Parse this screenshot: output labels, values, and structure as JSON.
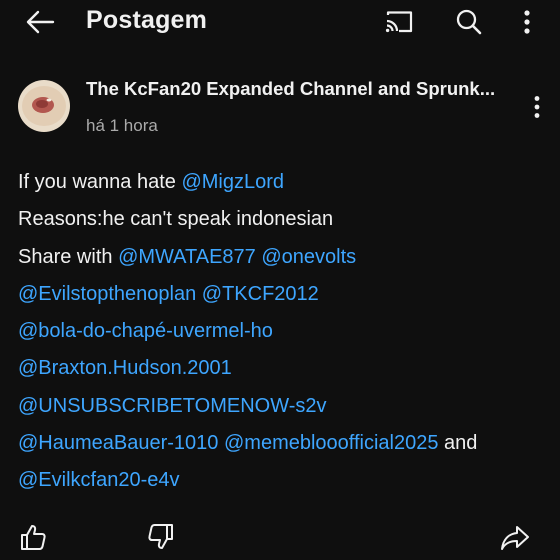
{
  "header": {
    "title": "Postagem",
    "icons": [
      "back-arrow-icon",
      "cast-icon",
      "search-icon",
      "more-vert-icon"
    ]
  },
  "post": {
    "channel_name": "The KcFan20 Expanded Channel and Sprunk...",
    "time_ago": "há 1 hora",
    "lines": [
      {
        "text": "If you wanna hate ",
        "mentions": [
          "@MigzLord"
        ]
      },
      {
        "text": "Reasons:he can't speak indonesian",
        "mentions": []
      },
      {
        "text": "Share with ",
        "mentions": [
          "@MWATAE877",
          "@onevolts"
        ]
      },
      {
        "text": "",
        "mentions": [
          "@Evilstopthenoplan",
          "@TKCF2012"
        ]
      },
      {
        "text": "",
        "mentions": [
          "@bola-do-chapé-uvermel-ho"
        ]
      },
      {
        "text": "",
        "mentions": [
          "@Braxton.Hudson.2001"
        ]
      },
      {
        "text": "",
        "mentions": [
          "@UNSUBSCRIBETOMENOW-s2v"
        ]
      },
      {
        "text": "",
        "mentions": [
          "@HaumeaBauer-1010",
          "@memeblooofficial2025"
        ],
        "suffix": " and"
      },
      {
        "text": "",
        "mentions": [
          "@Evilkcfan20-e4v"
        ]
      }
    ]
  },
  "colors": {
    "background": "#0f0f0f",
    "text": "#f1f1f1",
    "mention": "#3ea6ff",
    "muted": "#aaaaaa"
  },
  "actions": [
    "like-icon",
    "dislike-icon",
    "share-icon"
  ]
}
